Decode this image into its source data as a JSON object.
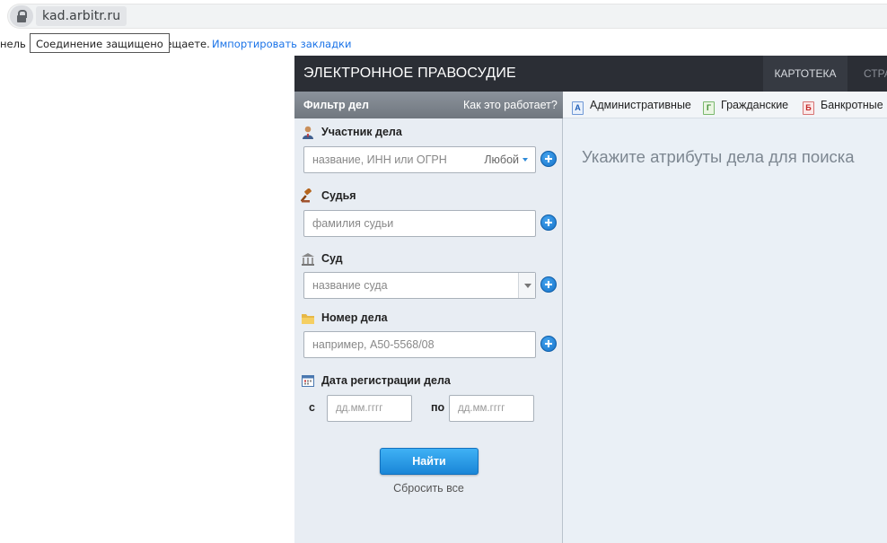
{
  "browser": {
    "url": "kad.arbitr.ru",
    "tooltip": "Соединение защищено",
    "bookmarks_left": "нель с",
    "bookmarks_mid": "сещаете.",
    "bookmarks_link": "Импортировать закладки"
  },
  "app": {
    "title": "ЭЛЕКТРОННОЕ ПРАВОСУДИЕ",
    "nav_tabs": [
      {
        "label": "КАРТОТЕКА",
        "active": true
      },
      {
        "label": "СТРА",
        "active": false
      }
    ],
    "filter_title": "Фильтр дел",
    "how_it_works": "Как это работает?",
    "case_tabs": [
      {
        "badge": "А",
        "label": "Административные",
        "color": "#1f5fb8"
      },
      {
        "badge": "Г",
        "label": "Гражданские",
        "color": "#3b8a2c"
      },
      {
        "badge": "Б",
        "label": "Банкротные",
        "color": "#c42626"
      }
    ],
    "hint": "Укажите атрибуты дела для поиска"
  },
  "filter": {
    "participant": {
      "label": "Участник дела",
      "placeholder": "название, ИНН или ОГРН",
      "type_select": "Любой",
      "icon": "person-icon"
    },
    "judge": {
      "label": "Судья",
      "placeholder": "фамилия судьи",
      "icon": "gavel-icon"
    },
    "court": {
      "label": "Суд",
      "placeholder": "название суда",
      "icon": "courthouse-icon"
    },
    "case_number": {
      "label": "Номер дела",
      "placeholder": "например, А50-5568/08",
      "icon": "folder-icon"
    },
    "date": {
      "label": "Дата регистрации дела",
      "from_label": "с",
      "to_label": "по",
      "from_placeholder": "дд.мм.гггг",
      "to_placeholder": "дд.мм.гггг",
      "icon": "calendar-icon"
    },
    "search_button": "Найти",
    "reset_link": "Сбросить все"
  },
  "colors": {
    "header_bg": "#2b2e35",
    "accent_blue": "#1a86d7",
    "panel_bg": "#e8edf3"
  }
}
